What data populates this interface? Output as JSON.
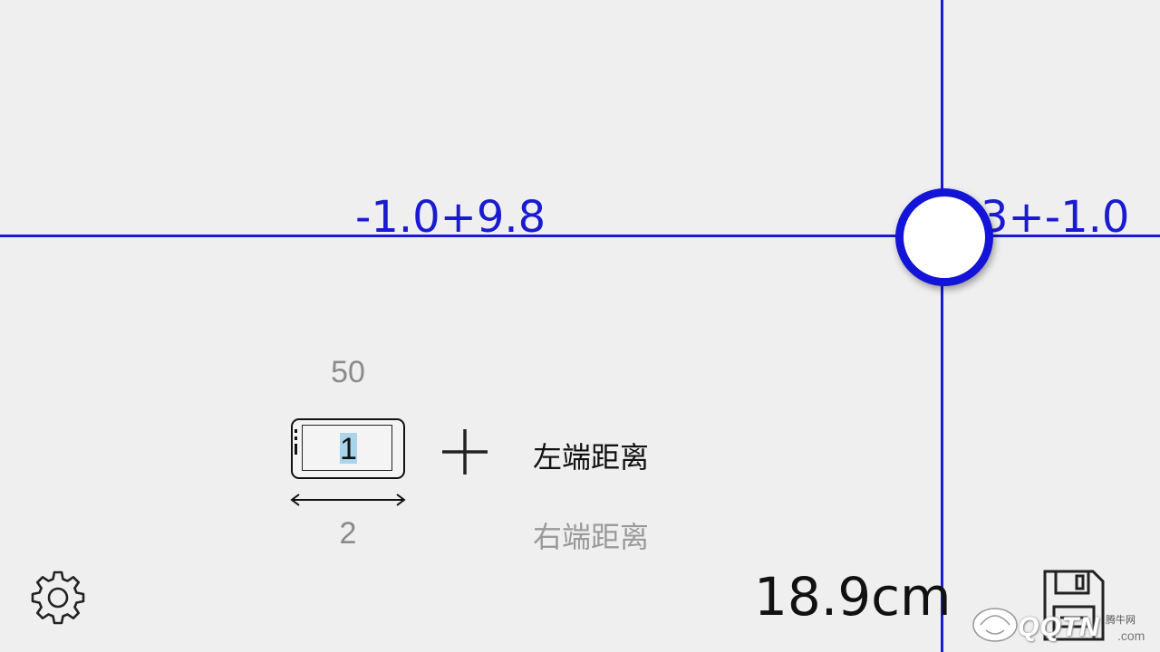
{
  "readouts": {
    "left": "-1.0+9.8",
    "right": "3+-1.0"
  },
  "calibration": {
    "count_top": "50",
    "phone_count": "1",
    "count_bottom": "2"
  },
  "modes": {
    "left_distance": "左端距离",
    "right_distance": "右端距离",
    "selected": "left_distance"
  },
  "measurement": {
    "value": "18.9cm"
  },
  "watermark": {
    "brand": "QQTN",
    "tagline": "腾牛网",
    "suffix": ".com"
  },
  "icons": {
    "settings": "gear-icon",
    "save": "floppy-disk-icon",
    "add": "plus-icon",
    "handle": "drag-handle"
  },
  "colors": {
    "accent": "#1a1ad0",
    "background": "#efefef",
    "highlight": "#a9d4ea",
    "muted_text": "#9a9a9a"
  }
}
